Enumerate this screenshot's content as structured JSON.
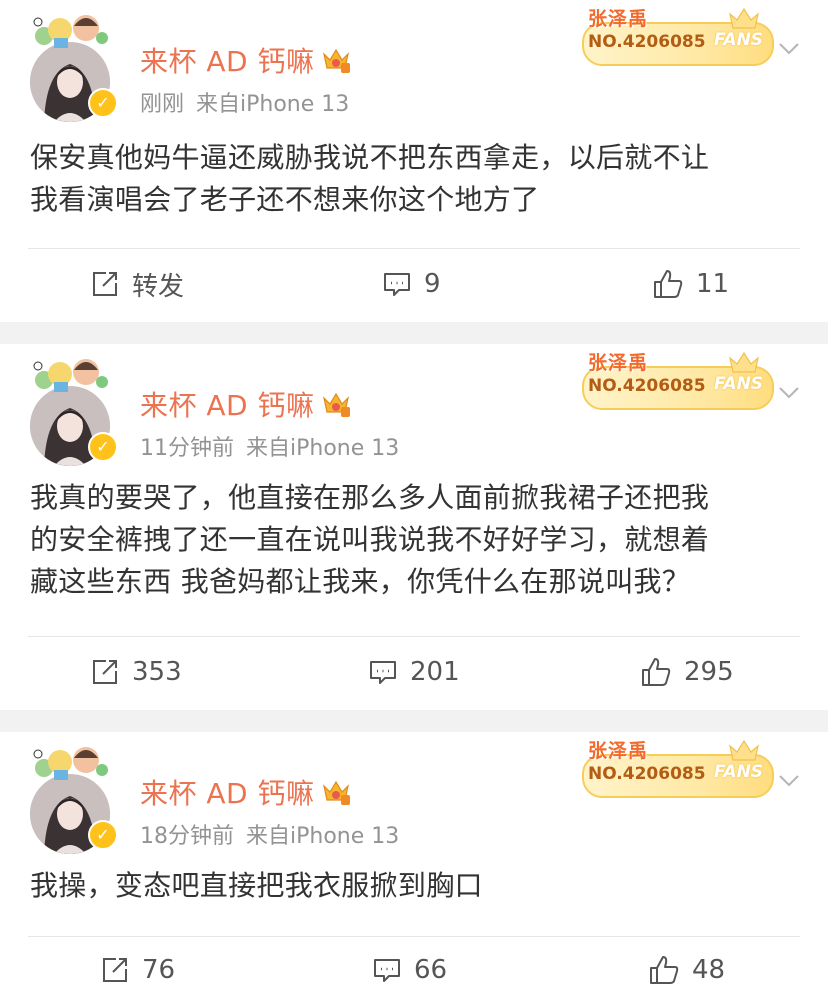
{
  "posts": [
    {
      "username": "来杯 AD 钙嘛",
      "time": "刚刚",
      "source": "来自iPhone 13",
      "fans_name": "张泽禹",
      "fans_no": "NO.4206085",
      "fans_word": "FANS",
      "body_lines": [
        "保安真他妈牛逼还威胁我说不把东西拿走，以后就不让",
        "我看演唱会了老子还不想来你这个地方了"
      ],
      "repost": "转发",
      "comments": "9",
      "likes": "11"
    },
    {
      "username": "来杯 AD 钙嘛",
      "time": "11分钟前",
      "source": "来自iPhone 13",
      "fans_name": "张泽禹",
      "fans_no": "NO.4206085",
      "fans_word": "FANS",
      "body_lines": [
        "我真的要哭了，他直接在那么多人面前掀我裙子还把我",
        "的安全裤拽了还一直在说叫我说我不好好学习，就想着",
        "藏这些东西 我爸妈都让我来，你凭什么在那说叫我？"
      ],
      "repost": "353",
      "comments": "201",
      "likes": "295"
    },
    {
      "username": "来杯 AD 钙嘛",
      "time": "18分钟前",
      "source": "来自iPhone 13",
      "fans_name": "张泽禹",
      "fans_no": "NO.4206085",
      "fans_word": "FANS",
      "body_lines": [
        "我操，变态吧直接把我衣服掀到胸口"
      ],
      "repost": "76",
      "comments": "66",
      "likes": "48"
    }
  ],
  "colors": {
    "username": "#eb7350",
    "meta": "#939393",
    "background": "#f2f2f2",
    "verified": "#ffc21a"
  }
}
